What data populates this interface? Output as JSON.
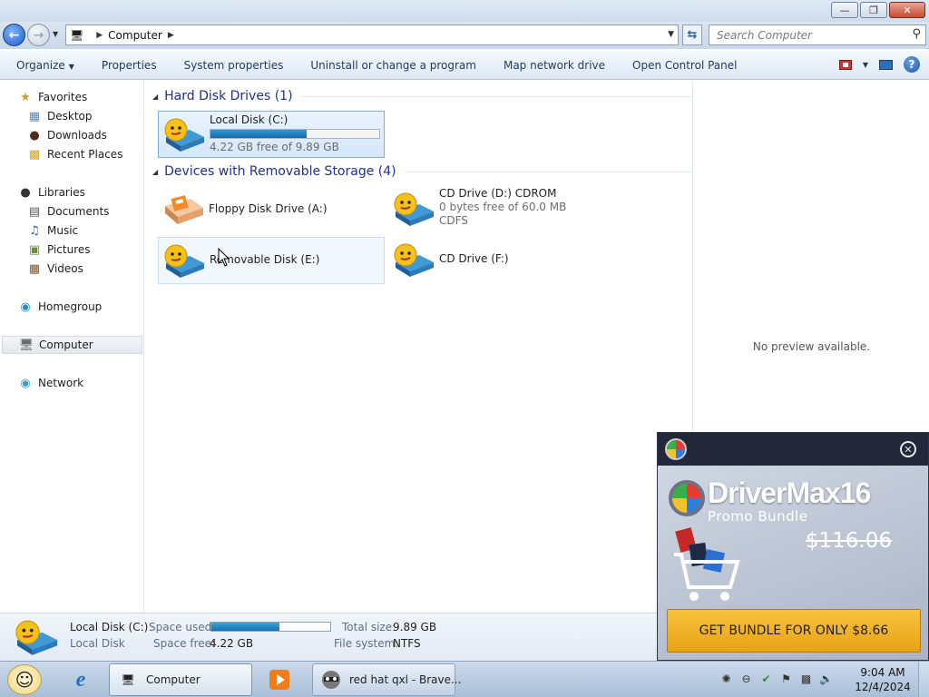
{
  "window": {
    "minimize_glyph": "—",
    "maximize_glyph": "❐",
    "close_glyph": "✕"
  },
  "address": {
    "crumb": "Computer",
    "search_placeholder": "Search Computer"
  },
  "commands": {
    "organize": "Organize",
    "properties": "Properties",
    "system_properties": "System properties",
    "uninstall": "Uninstall or change a program",
    "map_drive": "Map network drive",
    "control_panel": "Open Control Panel"
  },
  "nav": {
    "favorites": "Favorites",
    "desktop": "Desktop",
    "downloads": "Downloads",
    "recent_places": "Recent Places",
    "libraries": "Libraries",
    "documents": "Documents",
    "music": "Music",
    "pictures": "Pictures",
    "videos": "Videos",
    "homegroup": "Homegroup",
    "computer": "Computer",
    "network": "Network"
  },
  "groups": {
    "hard_disks": "Hard Disk Drives (1)",
    "removable": "Devices with Removable Storage (4)"
  },
  "drives": {
    "c": {
      "name": "Local Disk (C:)",
      "free": "4.22 GB free of 9.89 GB",
      "used_fraction": 0.57
    },
    "a": {
      "name": "Floppy Disk Drive (A:)"
    },
    "d": {
      "name": "CD Drive (D:) CDROM",
      "free": "0 bytes free of 60.0 MB",
      "fs": "CDFS"
    },
    "e": {
      "name": "Removable Disk (E:)"
    },
    "f": {
      "name": "CD Drive (F:)"
    }
  },
  "preview": {
    "message": "No preview available."
  },
  "details": {
    "name": "Local Disk (C:)",
    "type": "Local Disk",
    "space_used_label": "Space used:",
    "space_free_label": "Space free:",
    "space_free": "4.22 GB",
    "total_size_label": "Total size:",
    "total_size": "9.89 GB",
    "filesystem_label": "File system:",
    "filesystem": "NTFS",
    "used_fraction": 0.57
  },
  "promo": {
    "title": "DriverMax16",
    "subtitle": "Promo Bundle",
    "old_price": "$116.06",
    "button": "GET BUNDLE FOR ONLY $8.66"
  },
  "taskbar": {
    "ie_glyph": "e",
    "explorer_label": "Computer",
    "browser_label": "red hat qxl - Brave...",
    "time": "9:04 AM",
    "date": "12/4/2024"
  },
  "colors": {
    "accent_bar": "#1a6aa8",
    "group_header": "#1e3287",
    "promo_button": "#f0b42a"
  }
}
